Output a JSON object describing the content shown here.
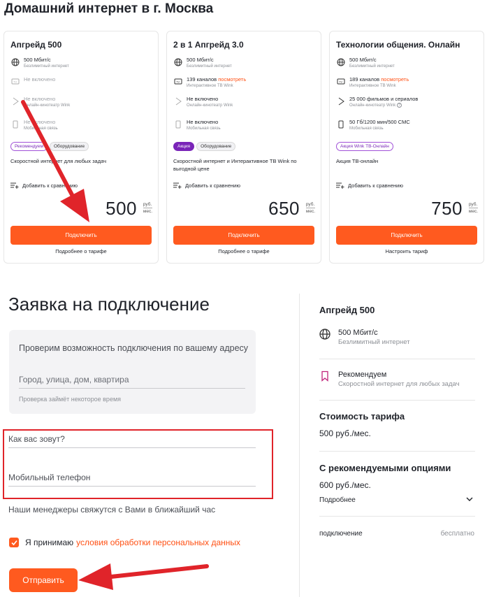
{
  "page_title": "Домашний интернет в г. Москва",
  "cards": [
    {
      "title": "Апгрейд 500",
      "features": [
        {
          "icon": "globe-icon",
          "main": "500 Мбит/с",
          "sub": "Безлимитный интернет",
          "dim": false,
          "link": ""
        },
        {
          "icon": "tv-icon",
          "main": "Не включено",
          "sub": "",
          "dim": true,
          "link": ""
        },
        {
          "icon": "play-icon",
          "main": "Не включено",
          "sub": "Онлайн-кинотеатр Wink",
          "dim": true,
          "link": ""
        },
        {
          "icon": "phone-icon",
          "main": "Не включено",
          "sub": "Мобильная связь",
          "dim": true,
          "link": ""
        }
      ],
      "tags": [
        {
          "label": "Рекомендуем",
          "kind": "rec"
        },
        {
          "label": "Оборудование",
          "kind": "plain"
        }
      ],
      "desc": "Скоростной интернет для любых задач",
      "compare": "Добавить к сравнению",
      "price": "500",
      "unit_top": "руб.",
      "unit_bottom": "мес.",
      "button": "Подключить",
      "more": "Подробнее о тарифе"
    },
    {
      "title": "2 в 1 Апгрейд 3.0",
      "features": [
        {
          "icon": "globe-icon",
          "main": "500 Мбит/с",
          "sub": "Безлимитный интернет",
          "dim": false,
          "link": ""
        },
        {
          "icon": "tv-icon",
          "main": "139 каналов",
          "sub": "Интерактивное ТВ Wink",
          "dim": false,
          "link": "посмотреть"
        },
        {
          "icon": "play-icon",
          "main": "Не включено",
          "sub": "Онлайн-кинотеатр Wink",
          "dim": true,
          "link": ""
        },
        {
          "icon": "phone-icon",
          "main": "Не включено",
          "sub": "Мобильная связь",
          "dim": true,
          "link": ""
        }
      ],
      "tags": [
        {
          "label": "Акция",
          "kind": "promo"
        },
        {
          "label": "Оборудование",
          "kind": "plain"
        }
      ],
      "desc": "Скоростной интернет и Интерактивное ТВ Wink по выгодной цене",
      "compare": "Добавить к сравнению",
      "price": "650",
      "unit_top": "руб.",
      "unit_bottom": "мес.",
      "button": "Подключить",
      "more": "Подробнее о тарифе"
    },
    {
      "title": "Технологии общения. Онлайн",
      "features": [
        {
          "icon": "globe-icon",
          "main": "500 Мбит/с",
          "sub": "Безлимитный интернет",
          "dim": false,
          "link": ""
        },
        {
          "icon": "tv-icon",
          "main": "189 каналов",
          "sub": "Интерактивное ТВ Wink",
          "dim": false,
          "link": "посмотреть"
        },
        {
          "icon": "play-icon",
          "main": "25 000 фильмов и сериалов",
          "sub": "Онлайн-кинотеатр Wink",
          "dim": false,
          "link": ""
        },
        {
          "icon": "phone-icon",
          "main": "50 Гб/1200 мин/500 СМС",
          "sub": "Мобильная связь",
          "dim": false,
          "link": ""
        }
      ],
      "tags": [
        {
          "label": "Акция Wink ТВ-Онлайн",
          "kind": "rec"
        }
      ],
      "desc": "Акция ТВ-онлайн",
      "compare": "Добавить к сравнению",
      "price": "750",
      "unit_top": "руб.",
      "unit_bottom": "мес.",
      "button": "Подключить",
      "more": "Настроить тариф"
    }
  ],
  "form": {
    "title": "Заявка на подключение",
    "address_header": "Проверим возможность подключения по вашему адресу",
    "address_placeholder": "Город, улица, дом, квартира",
    "address_hint": "Проверка займёт некоторое время",
    "name_placeholder": "Как вас зовут?",
    "phone_placeholder": "Мобильный телефон",
    "contact_note": "Наши менеджеры свяжутся с Вами в ближайший час",
    "agree_text": "Я принимаю",
    "agree_link": "условия обработки персональных данных",
    "submit": "Отправить"
  },
  "summary": {
    "title": "Апгрейд 500",
    "speed": "500 Мбит/с",
    "speed_sub": "Безлимитный интернет",
    "rec": "Рекомендуем",
    "rec_sub": "Скоростной интернет для любых задач",
    "cost_label": "Стоимость тарифа",
    "cost_value": "500 руб./мес.",
    "options_label": "С рекомендуемыми опциями",
    "options_value": "600 руб./мес.",
    "details": "Подробнее",
    "connection_label": "подключение",
    "connection_value": "бесплатно"
  },
  "colors": {
    "accent": "#ff5a1f",
    "annotation": "#e0242a",
    "promo": "#7a25b8"
  }
}
